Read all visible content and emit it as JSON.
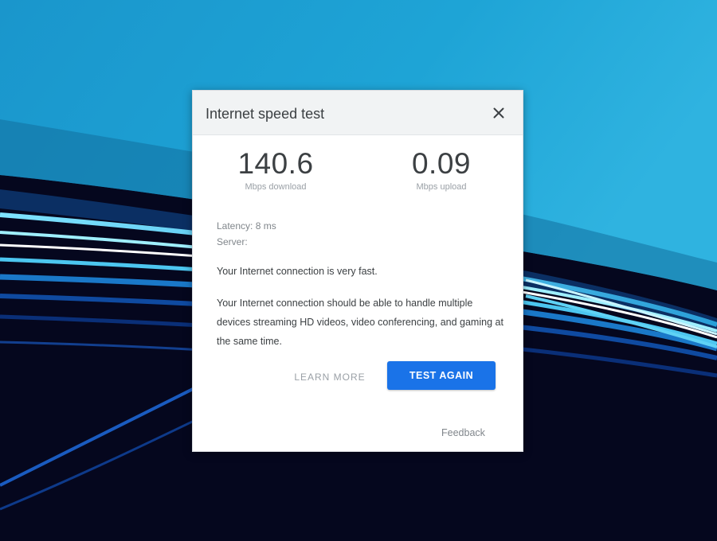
{
  "dialog": {
    "title": "Internet speed test",
    "close_icon": "close-icon",
    "download": {
      "value": "140.6",
      "unit": "Mbps download"
    },
    "upload": {
      "value": "0.09",
      "unit": "Mbps upload"
    },
    "latency": "Latency: 8 ms",
    "server": "Server:",
    "verdict": "Your Internet connection is very fast.",
    "description": "Your Internet connection should be able to handle multiple devices streaming HD videos, video conferencing, and gaming at the same time.",
    "learn_more_label": "LEARN MORE",
    "test_again_label": "TEST AGAIN",
    "feedback_label": "Feedback"
  },
  "colors": {
    "accent": "#1a73e8",
    "header_bg": "#f1f3f4",
    "wallpaper_dark": "#05071e",
    "wallpaper_blue": "#1c9fd3"
  }
}
